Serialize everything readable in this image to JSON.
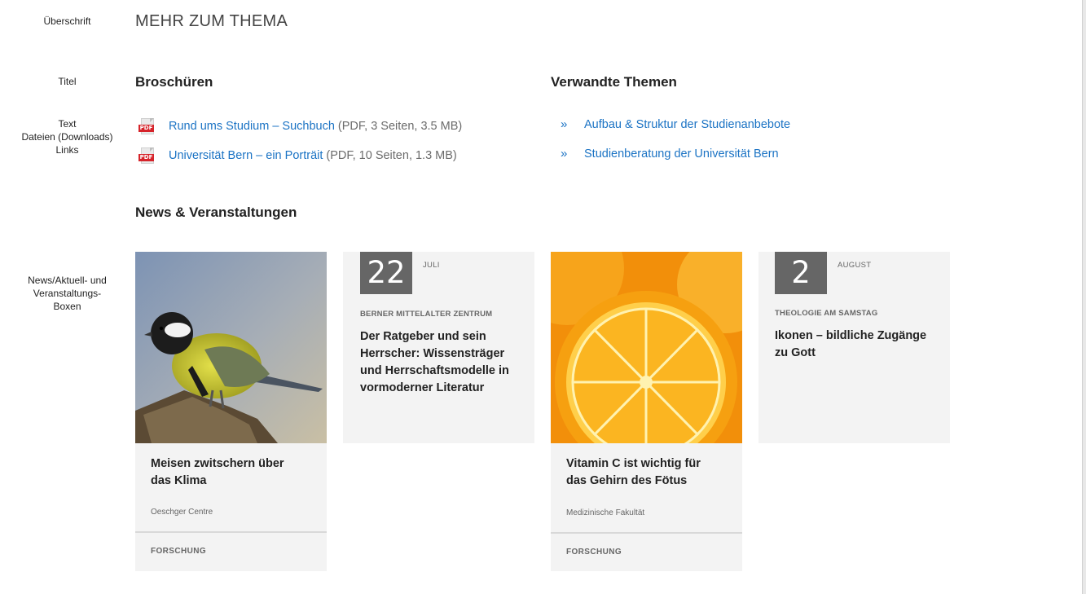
{
  "annotations": {
    "heading": "Überschrift",
    "title": "Titel",
    "text_lines": [
      "Text",
      "Dateien (Downloads)",
      "Links"
    ],
    "boxes_lines": [
      "News/Aktuell- und",
      "Veranstaltungs-",
      "Boxen"
    ]
  },
  "page_heading": "MEHR ZUM THEMA",
  "brochures": {
    "title": "Broschüren",
    "icon_tag": "PDF",
    "files": [
      {
        "label": "Rund ums Studium – Suchbuch",
        "meta": "(PDF, 3 Seiten, 3.5 MB)",
        "icon": "pdf-icon"
      },
      {
        "label": "Universität Bern – ein Porträit",
        "meta": "(PDF, 10 Seiten, 1.3 MB)",
        "icon": "pdf-icon"
      }
    ]
  },
  "related": {
    "title": "Verwandte Themen",
    "marker": "»",
    "links": [
      {
        "label": "Aufbau & Struktur der Studienanbebote"
      },
      {
        "label": "Studienberatung der Universität Bern"
      }
    ]
  },
  "news": {
    "title": "News & Veranstaltungen",
    "cards": [
      {
        "type": "news",
        "image": "bird-photo",
        "title_lines": [
          "Meisen zwitschern über",
          "das Klima"
        ],
        "org": "Oeschger Centre",
        "category": "FORSCHUNG"
      },
      {
        "type": "event",
        "day": "22",
        "month": "JULI",
        "category": "BERNER MITTELALTER ZENTRUM",
        "title_lines": [
          "Der Ratgeber und sein",
          "Herrscher: Wissensträger",
          "und Herrschaftsmodelle in",
          "vormoderner Literatur"
        ]
      },
      {
        "type": "news",
        "image": "orange-photo",
        "title_lines": [
          "Vitamin C ist wichtig für",
          "das Gehirn des Fötus"
        ],
        "org": "Medizinische Fakultät",
        "category": "FORSCHUNG"
      },
      {
        "type": "event",
        "day": "2",
        "month": "AUGUST",
        "category": "THEOLOGIE AM SAMSTAG",
        "title_lines": [
          "Ikonen – bildliche Zugänge",
          "zu Gott"
        ]
      }
    ]
  },
  "colors": {
    "link": "#1b73c4",
    "card_bg": "#f3f3f3",
    "date_box": "#666666",
    "pdf_red": "#d6232a"
  }
}
